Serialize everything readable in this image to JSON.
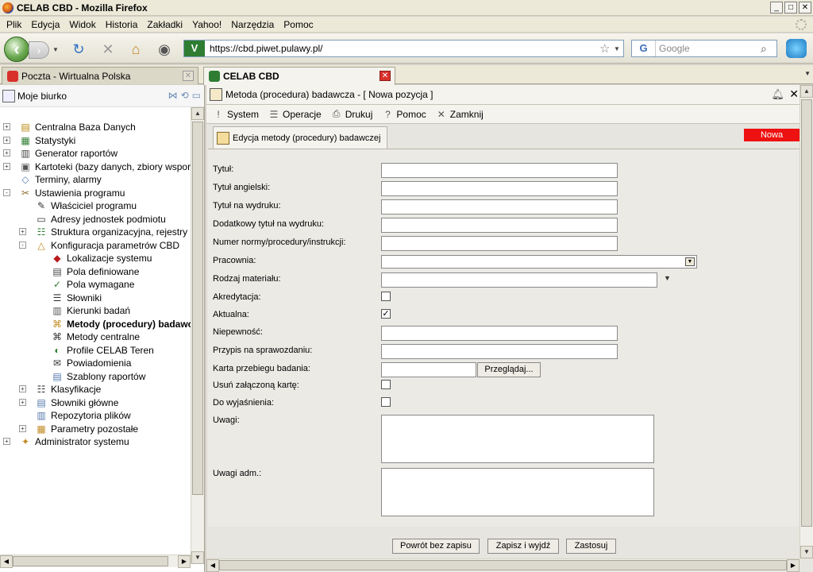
{
  "window": {
    "title": "CELAB CBD - Mozilla Firefox"
  },
  "menu": [
    "Plik",
    "Edycja",
    "Widok",
    "Historia",
    "Zakładki",
    "Yahoo!",
    "Narzędzia",
    "Pomoc"
  ],
  "nav": {
    "url": "https://cbd.piwet.pulawy.pl/",
    "search_placeholder": "Google",
    "search_engine": "G"
  },
  "tabs": [
    {
      "label": "Poczta - Wirtualna Polska",
      "active": false
    },
    {
      "label": "CELAB CBD",
      "active": true
    }
  ],
  "left_panel": {
    "title": "Moje biurko",
    "tree": [
      {
        "label": "Centralna Baza Danych",
        "level": 0,
        "expander": "+",
        "icon": "database-icon"
      },
      {
        "label": "Statystyki",
        "level": 0,
        "expander": "+",
        "icon": "statistics-icon"
      },
      {
        "label": "Generator raportów",
        "level": 0,
        "expander": "+",
        "icon": "report-generator-icon"
      },
      {
        "label": "Kartoteki (bazy danych, zbiory wspor",
        "level": 0,
        "expander": "+",
        "icon": "card-index-icon"
      },
      {
        "label": "Terminy, alarmy",
        "level": 0,
        "expander": "",
        "icon": "alarm-icon"
      },
      {
        "label": "Ustawienia programu",
        "level": 0,
        "expander": "-",
        "icon": "settings-icon"
      },
      {
        "label": "Właściciel programu",
        "level": 1,
        "expander": "",
        "icon": "owner-icon"
      },
      {
        "label": "Adresy jednostek podmiotu",
        "level": 1,
        "expander": "",
        "icon": "address-icon"
      },
      {
        "label": "Struktura organizacyjna, rejestry",
        "level": 1,
        "expander": "+",
        "icon": "org-structure-icon"
      },
      {
        "label": "Konfiguracja parametrów CBD",
        "level": 1,
        "expander": "-",
        "icon": "config-icon"
      },
      {
        "label": "Lokalizacje systemu",
        "level": 2,
        "expander": "",
        "icon": "location-icon"
      },
      {
        "label": "Pola definiowane",
        "level": 2,
        "expander": "",
        "icon": "defined-fields-icon"
      },
      {
        "label": "Pola wymagane",
        "level": 2,
        "expander": "",
        "icon": "required-fields-icon"
      },
      {
        "label": "Słowniki",
        "level": 2,
        "expander": "",
        "icon": "dictionary-icon"
      },
      {
        "label": "Kierunki badań",
        "level": 2,
        "expander": "",
        "icon": "research-direction-icon"
      },
      {
        "label": "Metody (procedury) badawc",
        "level": 2,
        "expander": "",
        "icon": "method-icon",
        "bold": true
      },
      {
        "label": "Metody centralne",
        "level": 2,
        "expander": "",
        "icon": "central-method-icon"
      },
      {
        "label": "Profile CELAB Teren",
        "level": 2,
        "expander": "",
        "icon": "profile-icon"
      },
      {
        "label": "Powiadomienia",
        "level": 2,
        "expander": "",
        "icon": "notification-icon"
      },
      {
        "label": "Szablony raportów",
        "level": 2,
        "expander": "",
        "icon": "report-template-icon"
      },
      {
        "label": "Klasyfikacje",
        "level": 1,
        "expander": "+",
        "icon": "classification-icon"
      },
      {
        "label": "Słowniki główne",
        "level": 1,
        "expander": "+",
        "icon": "main-dictionary-icon"
      },
      {
        "label": "Repozytoria plików",
        "level": 1,
        "expander": "",
        "icon": "file-repository-icon"
      },
      {
        "label": "Parametry pozostałe",
        "level": 1,
        "expander": "+",
        "icon": "other-params-icon"
      },
      {
        "label": "Administrator systemu",
        "level": 0,
        "expander": "+",
        "icon": "admin-icon"
      }
    ]
  },
  "right_panel": {
    "title": "Metoda (procedura) badawcza - [ Nowa pozycja ]",
    "toolbar": [
      "System",
      "Operacje",
      "Drukuj",
      "Pomoc",
      "Zamknij"
    ],
    "subtab": "Edycja metody (procedury) badawczej",
    "status_badge": "Nowa",
    "status_color": "#ee1111",
    "fields": {
      "tytul": "Tytuł:",
      "tytul_ang": "Tytuł angielski:",
      "tytul_wydruk": "Tytuł na wydruku:",
      "dod_tytul": "Dodatkowy tytuł na wydruku:",
      "numer_normy": "Numer normy/procedury/instrukcji:",
      "pracownia": "Pracownia:",
      "rodzaj": "Rodzaj materiału:",
      "akredytacja": "Akredytacja:",
      "aktualna": "Aktualna:",
      "niepewnosc": "Niepewność:",
      "przypis": "Przypis na sprawozdaniu:",
      "karta": "Karta przebiegu badania:",
      "usun": "Usuń załączoną kartę:",
      "wyjasnienia": "Do wyjaśnienia:",
      "uwagi": "Uwagi:",
      "uwagi_adm": "Uwagi adm.:"
    },
    "checks": {
      "akredytacja": false,
      "aktualna": true,
      "usun": false,
      "wyjasnienia": false
    },
    "browse_button": "Przeglądaj...",
    "buttons": [
      "Powrót bez zapisu",
      "Zapisz i wyjdź",
      "Zastosuj"
    ]
  }
}
